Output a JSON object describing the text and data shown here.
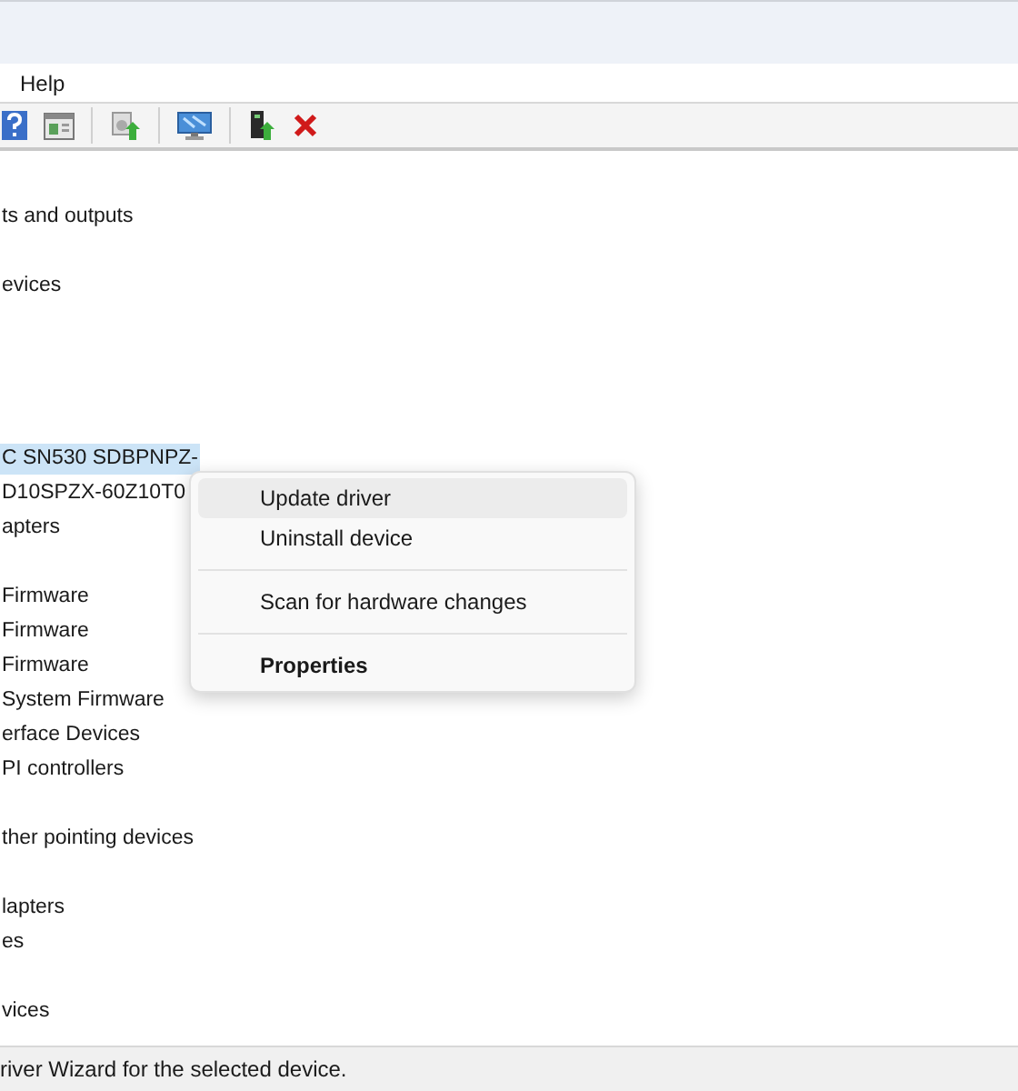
{
  "menu_bar": [
    {
      "label": "Help"
    }
  ],
  "toolbar": [
    {
      "kind": "help"
    },
    {
      "kind": "properties"
    },
    {
      "kind": "separator"
    },
    {
      "kind": "update"
    },
    {
      "kind": "separator"
    },
    {
      "kind": "scan"
    },
    {
      "kind": "separator"
    },
    {
      "kind": "enable"
    },
    {
      "kind": "remove"
    }
  ],
  "tree": [
    {
      "kind": "blank"
    },
    {
      "kind": "node",
      "text": "ts and outputs",
      "selected": false
    },
    {
      "kind": "blank"
    },
    {
      "kind": "node",
      "text": "evices",
      "selected": false
    },
    {
      "kind": "blank"
    },
    {
      "kind": "blank"
    },
    {
      "kind": "blank"
    },
    {
      "kind": "blank"
    },
    {
      "kind": "node",
      "text": "C SN530 SDBPNPZ-",
      "selected": true
    },
    {
      "kind": "node",
      "text": "D10SPZX-60Z10T0",
      "selected": false
    },
    {
      "kind": "node",
      "text": "apters",
      "selected": false
    },
    {
      "kind": "blank"
    },
    {
      "kind": "node",
      "text": "Firmware",
      "selected": false
    },
    {
      "kind": "node",
      "text": "Firmware",
      "selected": false
    },
    {
      "kind": "node",
      "text": "Firmware",
      "selected": false
    },
    {
      "kind": "node",
      "text": "System Firmware",
      "selected": false
    },
    {
      "kind": "node",
      "text": "erface Devices",
      "selected": false
    },
    {
      "kind": "node",
      "text": "PI controllers",
      "selected": false
    },
    {
      "kind": "blank"
    },
    {
      "kind": "node",
      "text": "ther pointing devices",
      "selected": false
    },
    {
      "kind": "blank"
    },
    {
      "kind": "node",
      "text": "lapters",
      "selected": false
    },
    {
      "kind": "node",
      "text": "es",
      "selected": false
    },
    {
      "kind": "blank"
    },
    {
      "kind": "node",
      "text": "vices",
      "selected": false
    }
  ],
  "context_menu": [
    {
      "kind": "item",
      "label": "Update driver",
      "highlighted": true,
      "default": false
    },
    {
      "kind": "item",
      "label": "Uninstall device",
      "highlighted": false,
      "default": false
    },
    {
      "kind": "separator"
    },
    {
      "kind": "item",
      "label": "Scan for hardware changes",
      "highlighted": false,
      "default": false
    },
    {
      "kind": "separator"
    },
    {
      "kind": "item",
      "label": "Properties",
      "highlighted": false,
      "default": true
    }
  ],
  "status_bar": "river Wizard for the selected device."
}
